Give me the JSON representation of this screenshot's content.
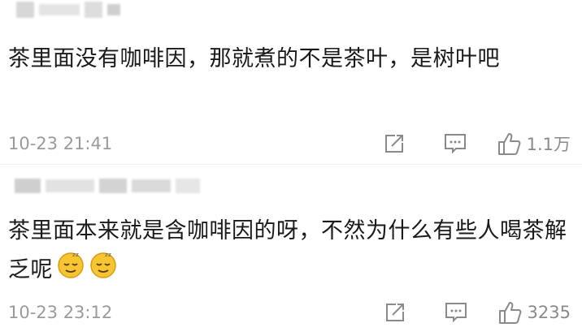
{
  "comments": [
    {
      "text": "茶里面没有咖啡因，那就煮的不是茶叶，是树叶吧",
      "time": "10-23 21:41",
      "likes": "1.1万"
    },
    {
      "text": "茶里面本来就是含咖啡因的呀，不然为什么有些人喝茶解乏呢",
      "time": "10-23 23:12",
      "likes": "3235"
    }
  ],
  "icons": {
    "share": "share-icon",
    "comment": "comment-icon",
    "like": "thumbs-up-icon",
    "emoji": "sleepy-face-emoji"
  },
  "colors": {
    "meta_text": "#9a9a9a",
    "icon": "#8a8a8a"
  }
}
